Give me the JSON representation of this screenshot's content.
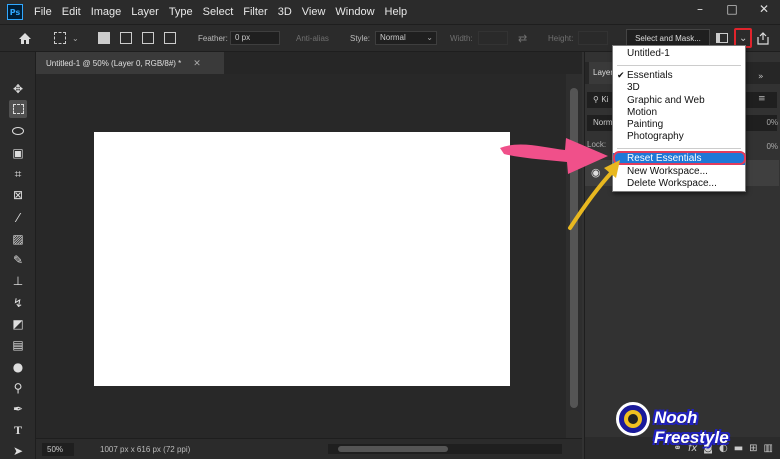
{
  "app": {
    "logo": "Ps"
  },
  "menu": [
    "File",
    "Edit",
    "Image",
    "Layer",
    "Type",
    "Select",
    "Filter",
    "3D",
    "View",
    "Window",
    "Help"
  ],
  "window_controls": {
    "minimize": "–",
    "maximize": "□",
    "close": "✕"
  },
  "options": {
    "feather_label": "Feather:",
    "feather_value": "0 px",
    "antialias_label": "Anti-alias",
    "style_label": "Style:",
    "style_value": "Normal",
    "width_label": "Width:",
    "height_label": "Height:",
    "select_mask_label": "Select and Mask..."
  },
  "document": {
    "tab_title": "Untitled-1 @ 50% (Layer 0, RGB/8#) *",
    "zoom": "50%",
    "info": "1007 px x 616 px (72 ppi)"
  },
  "layers_panel": {
    "tab": "Layers",
    "search_text": "Ki",
    "blend_mode": "Norm",
    "opacity_pct": "0%",
    "lock_label": "Lock:",
    "fill_pct": "0%"
  },
  "workspace_menu": {
    "items": [
      {
        "label": "Untitled-1",
        "checked": false
      },
      {
        "label": "Essentials",
        "checked": true
      },
      {
        "label": "3D",
        "checked": false
      },
      {
        "label": "Graphic and Web",
        "checked": false
      },
      {
        "label": "Motion",
        "checked": false
      },
      {
        "label": "Painting",
        "checked": false
      },
      {
        "label": "Photography",
        "checked": false
      },
      {
        "label": "Reset Essentials",
        "checked": false,
        "highlighted": true
      },
      {
        "label": "New Workspace...",
        "checked": false
      },
      {
        "label": "Delete Workspace...",
        "checked": false
      }
    ]
  },
  "watermark": {
    "text": "Nooh Freestyle"
  },
  "colors": {
    "accent_highlight": "#1e78d7",
    "annotation_pink": "#f0508a",
    "annotation_yellow": "#e8b820",
    "annotation_red": "#e0242c"
  }
}
